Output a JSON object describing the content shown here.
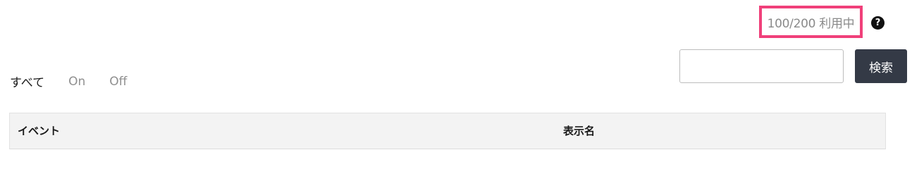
{
  "usage": {
    "text": "100/200 利用中",
    "highlight_color": "#f0407a",
    "help_icon": "question-circle-icon",
    "help_glyph": "?"
  },
  "filters": {
    "tabs": [
      {
        "label": "すべて",
        "active": true
      },
      {
        "label": "On",
        "active": false
      },
      {
        "label": "Off",
        "active": false
      }
    ]
  },
  "search": {
    "value": "",
    "placeholder": "",
    "button_label": "検索",
    "button_color": "#343a46"
  },
  "table": {
    "columns": [
      "イベント",
      "表示名"
    ]
  }
}
